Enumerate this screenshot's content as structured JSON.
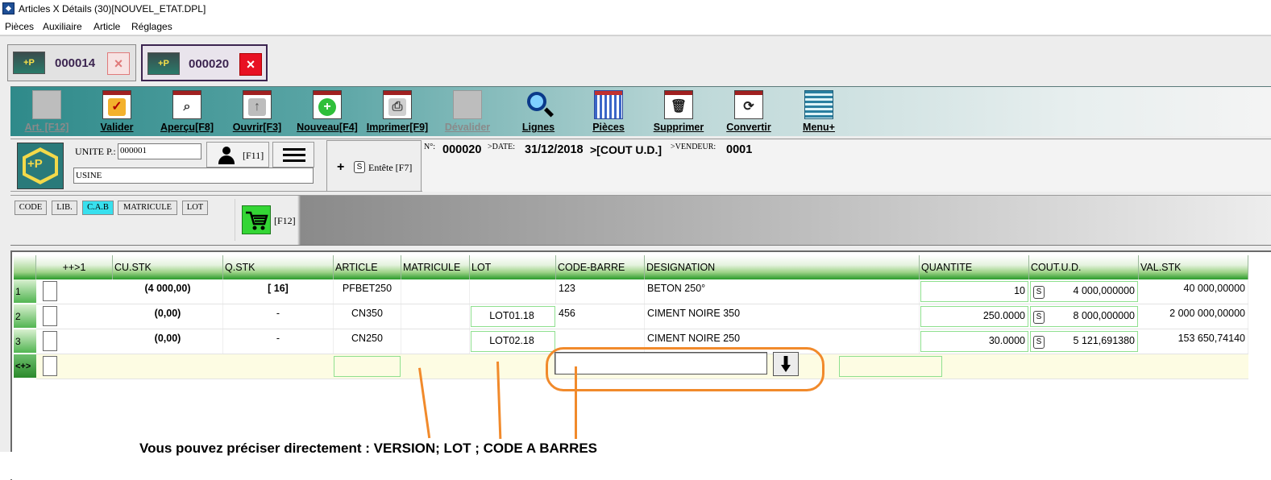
{
  "window": {
    "title": "Articles X Détails (30)[NOUVEL_ETAT.DPL]"
  },
  "menu": [
    "Pièces",
    "Auxiliaire",
    "Article",
    "Réglages"
  ],
  "doc_tabs": [
    {
      "number": "000014",
      "close": "×"
    },
    {
      "number": "000020",
      "close": "×"
    }
  ],
  "toolbar": [
    {
      "label": "Art. [F12]",
      "icon": "blank-icon",
      "disabled": true
    },
    {
      "label": "Valider",
      "icon": "check-icon"
    },
    {
      "label": "Aperçu[F8]",
      "icon": "magnifier-icon"
    },
    {
      "label": "Ouvrir[F3]",
      "icon": "open-icon"
    },
    {
      "label": "Nouveau[F4]",
      "icon": "add-icon"
    },
    {
      "label": "Imprimer[F9]",
      "icon": "printer-icon"
    },
    {
      "label": "Dévalider",
      "icon": "blank-icon",
      "disabled": true
    },
    {
      "label": "Lignes",
      "icon": "search-icon"
    },
    {
      "label": "Pièces",
      "icon": "grid-icon"
    },
    {
      "label": "Supprimer",
      "icon": "trash-icon"
    },
    {
      "label": "Convertir",
      "icon": "convert-icon"
    },
    {
      "label": "Menu+",
      "icon": "menu-icon"
    }
  ],
  "header": {
    "unite_label": "UNITE P.:",
    "unite_value": "000001",
    "usine_value": "USINE",
    "user_shortcut": "[F11]",
    "entete_plus": "+",
    "entete_s": "S",
    "entete_label": "Entête [F7]",
    "doc_prefix_no": "N°:",
    "doc_no": "000020",
    "doc_prefix_date": ">DATE:",
    "doc_date": "31/12/2018",
    "doc_cost": ">[COUT U.D.]",
    "doc_prefix_vendeur": ">VENDEUR:",
    "doc_vendeur": "0001"
  },
  "search_modes": [
    "CODE",
    "LIB.",
    "C.A.B",
    "MATRICULE",
    "LOT"
  ],
  "search_active": "C.A.B",
  "cart_shortcut": "[F12]",
  "grid": {
    "columns": [
      "++>1",
      "CU.STK",
      "Q.STK",
      "ARTICLE",
      "MATRICULE",
      "LOT",
      "CODE-BARRE",
      "DESIGNATION",
      "QUANTITE",
      "COUT.U.D.",
      "VAL.STK"
    ],
    "rows": [
      {
        "idx": "1",
        "cu_stk": "(4 000,00)",
        "q_stk": "[ 16]",
        "article": "PFBET250",
        "matricule": "",
        "lot": "",
        "code_barre": "123",
        "designation": "BETON 250°",
        "quantite": "10",
        "s": "S",
        "cout": "4 000,000000",
        "val": "40 000,00000"
      },
      {
        "idx": "2",
        "cu_stk": "(0,00)",
        "q_stk": "-",
        "article": "CN350",
        "matricule": "",
        "lot": "LOT01.18",
        "code_barre": "456",
        "designation": "CIMENT NOIRE 350",
        "quantite": "250.0000",
        "s": "S",
        "cout": "8 000,000000",
        "val": "2 000 000,00000"
      },
      {
        "idx": "3",
        "cu_stk": "(0,00)",
        "q_stk": "-",
        "article": "CN250",
        "matricule": "",
        "lot": "LOT02.18",
        "code_barre": "",
        "designation": "CIMENT NOIRE 250",
        "quantite": "30.0000",
        "s": "S",
        "cout": "5 121,691380",
        "val": "153 650,74140"
      }
    ],
    "new_row_marker": "<+>"
  },
  "callout": "Vous pouvez préciser directement : VERSION; LOT ; CODE A BARRES",
  "colors": {
    "accent_orange": "#f18a2b",
    "header_green": "#2a9a2a",
    "active_mode": "#38e0ee"
  }
}
